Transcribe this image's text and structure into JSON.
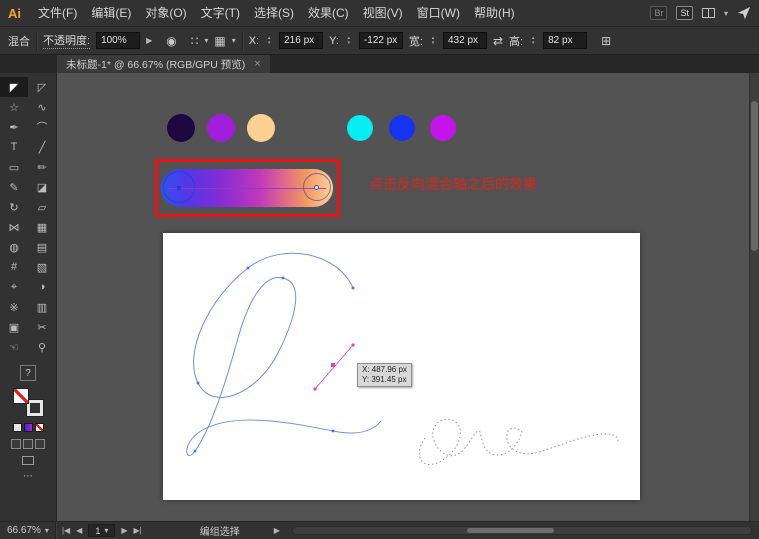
{
  "app": {
    "logo": "Ai"
  },
  "menubar": {
    "items": [
      "文件(F)",
      "编辑(E)",
      "对象(O)",
      "文字(T)",
      "选择(S)",
      "效果(C)",
      "视图(V)",
      "窗口(W)",
      "帮助(H)"
    ],
    "bridge_badge": "Br",
    "stock_badge": "St"
  },
  "icons": {
    "caret_down": "▾",
    "chevron_right": "▶",
    "nav_first": "|◀",
    "nav_prev": "◀",
    "nav_next": "▶",
    "nav_last": "▶|",
    "stepper_up": "▴",
    "stepper_down": "▾",
    "recolor": "◉",
    "align": "∷",
    "distribute": "▦",
    "constrain": "⇄",
    "transform": "⊞"
  },
  "options_bar": {
    "mode_label": "混合",
    "opacity_label": "不透明度:",
    "opacity_value": "100%",
    "x_label": "X:",
    "x_value": "216 px",
    "y_label": "Y:",
    "y_value": "-122 px",
    "width_label": "宽:",
    "width_value": "432 px",
    "height_label": "高:",
    "height_value": "82 px"
  },
  "tabbar": {
    "title": "未标题-1* @ 66.67% (RGB/GPU 预览)",
    "close": "×"
  },
  "toolbar": {
    "unknown_badge": "?",
    "more": "⋯",
    "tools": [
      {
        "name": "selection-tool",
        "glyph": "◤"
      },
      {
        "name": "direct-selection-tool",
        "glyph": "◸"
      },
      {
        "name": "magic-wand-tool",
        "glyph": "☆"
      },
      {
        "name": "lasso-tool",
        "glyph": "∿"
      },
      {
        "name": "pen-tool",
        "glyph": "✒"
      },
      {
        "name": "curvature-tool",
        "glyph": "⌒"
      },
      {
        "name": "type-tool",
        "glyph": "T"
      },
      {
        "name": "line-tool",
        "glyph": "╱"
      },
      {
        "name": "rectangle-tool",
        "glyph": "▭"
      },
      {
        "name": "paintbrush-tool",
        "glyph": "✏"
      },
      {
        "name": "pencil-tool",
        "glyph": "✎"
      },
      {
        "name": "eraser-tool",
        "glyph": "◪"
      },
      {
        "name": "rotate-tool",
        "glyph": "↻"
      },
      {
        "name": "scale-tool",
        "glyph": "▱"
      },
      {
        "name": "width-tool",
        "glyph": "⋈"
      },
      {
        "name": "free-transform-tool",
        "glyph": "▦"
      },
      {
        "name": "shape-builder-tool",
        "glyph": "◍"
      },
      {
        "name": "perspective-grid-tool",
        "glyph": "▤"
      },
      {
        "name": "mesh-tool",
        "glyph": "#"
      },
      {
        "name": "gradient-tool",
        "glyph": "▧"
      },
      {
        "name": "eyedropper-tool",
        "glyph": "⌖"
      },
      {
        "name": "blend-tool",
        "glyph": "◑"
      },
      {
        "name": "symbol-sprayer-tool",
        "glyph": "※"
      },
      {
        "name": "column-graph-tool",
        "glyph": "▥"
      },
      {
        "name": "artboard-tool",
        "glyph": "▣"
      },
      {
        "name": "slice-tool",
        "glyph": "✂"
      },
      {
        "name": "hand-tool",
        "glyph": "☜"
      },
      {
        "name": "zoom-tool",
        "glyph": "⚲"
      }
    ]
  },
  "canvas": {
    "annotation_text": "点击反向混合轴之后的效果",
    "annotation_color": "#dd2418",
    "highlight_box_color": "#f01212",
    "palette_left": [
      "#1f0741",
      "#a01ddd",
      "#fbd190"
    ],
    "palette_right": [
      "#06eef2",
      "#1633f1",
      "#c513eb"
    ],
    "blend_gradient": [
      "#2d51f0",
      "#7b2ed6",
      "#c23ab6",
      "#f2975f",
      "#fcd39b"
    ],
    "tooltip_line1": "X: 487.96 px",
    "tooltip_line2": "Y: 391.45 px"
  },
  "statusbar": {
    "zoom": "66.67%",
    "artboard": "1",
    "status": "编组选择"
  }
}
